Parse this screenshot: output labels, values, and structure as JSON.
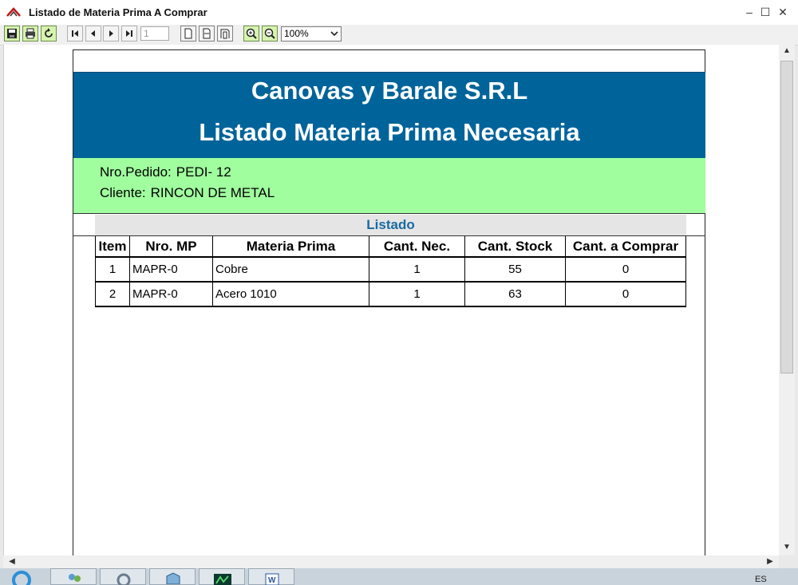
{
  "window": {
    "title": "Listado de Materia Prima A Comprar"
  },
  "toolbar": {
    "page_number": "1",
    "zoom": "100%"
  },
  "report": {
    "company": "Canovas y Barale S.R.L",
    "title": "Listado Materia Prima Necesaria",
    "pedido_label": "Nro.Pedido:",
    "pedido_value": "PEDI- 12",
    "cliente_label": "Cliente:",
    "cliente_value": "RINCON DE METAL",
    "section_title": "Listado",
    "columns": [
      "Item",
      "Nro. MP",
      "Materia Prima",
      "Cant. Nec.",
      "Cant. Stock",
      "Cant. a Comprar"
    ],
    "rows": [
      {
        "item": "1",
        "nro_mp": "MAPR-0",
        "materia": "Cobre",
        "nec": "1",
        "stock": "55",
        "comprar": "0"
      },
      {
        "item": "2",
        "nro_mp": "MAPR-0",
        "materia": "Acero 1010",
        "nec": "1",
        "stock": "63",
        "comprar": "0"
      }
    ]
  },
  "taskbar": {
    "language": "ES"
  },
  "colors": {
    "banner": "#00649a",
    "info_box": "#a0fe9e",
    "section_title": "#1a6aa0"
  }
}
